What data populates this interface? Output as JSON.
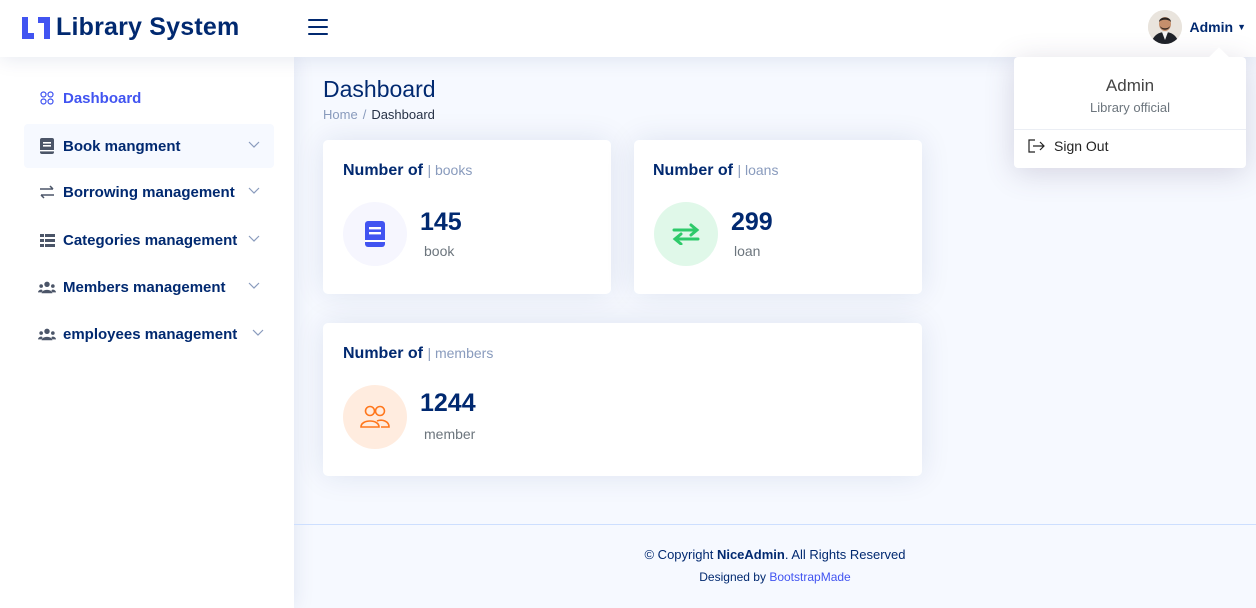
{
  "header": {
    "logo_text": "Library System",
    "user_name": "Admin"
  },
  "sidebar": {
    "items": [
      {
        "label": "Dashboard",
        "icon": "grid-icon"
      },
      {
        "label": "Book mangment",
        "icon": "book-icon"
      },
      {
        "label": "Borrowing management",
        "icon": "arrows-swap-icon"
      },
      {
        "label": "Categories management",
        "icon": "list-icon"
      },
      {
        "label": "Members management",
        "icon": "people-icon"
      },
      {
        "label": "employees management",
        "icon": "people-icon"
      }
    ]
  },
  "page": {
    "title": "Dashboard",
    "breadcrumb": [
      "Home",
      "/",
      "Dashboard"
    ]
  },
  "cards": [
    {
      "title": "Number of",
      "subtitle": "| books",
      "value": "145",
      "unit": "book",
      "icon": "book-icon"
    },
    {
      "title": "Number of",
      "subtitle": "| loans",
      "value": "299",
      "unit": "loan",
      "icon": "arrows-swap-icon"
    },
    {
      "title": "Number of",
      "subtitle": "| members",
      "value": "1244",
      "unit": "member",
      "icon": "people-icon"
    }
  ],
  "dropdown": {
    "name": "Admin",
    "role": "Library official",
    "signout_label": "Sign Out"
  },
  "footer": {
    "copyright_prefix": "© Copyright",
    "brand": "NiceAdmin",
    "rights": ". All Rights Reserved",
    "designed_by": "Designed by",
    "designer": "BootstrapMade"
  },
  "colors": {
    "primary": "#4154f1",
    "navy": "#012970",
    "green": "#2eca6a",
    "orange": "#ff771d"
  }
}
